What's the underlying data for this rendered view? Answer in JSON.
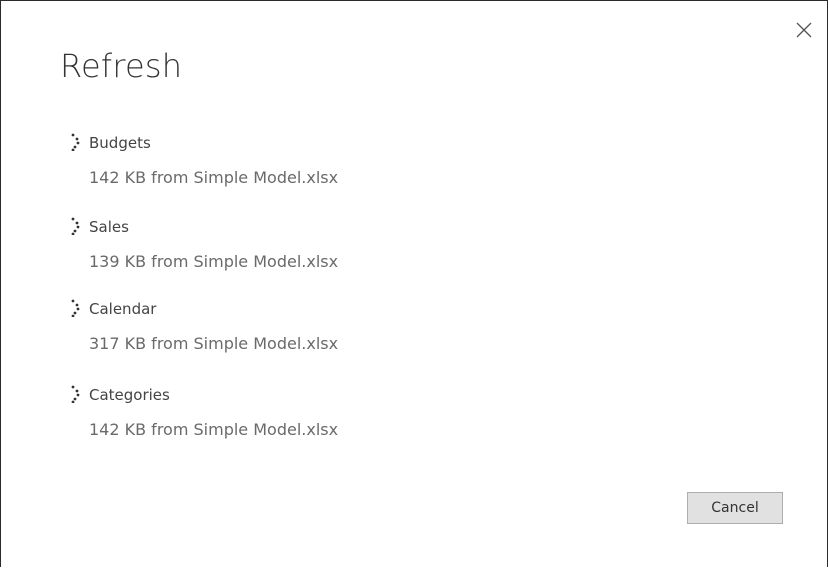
{
  "dialog": {
    "title": "Refresh",
    "close_icon": "close-icon",
    "cancel_label": "Cancel"
  },
  "queries": [
    {
      "name": "Budgets",
      "detail": "142 KB from Simple Model.xlsx",
      "icon": "loading-spinner-icon"
    },
    {
      "name": "Sales",
      "detail": "139 KB from Simple Model.xlsx",
      "icon": "loading-spinner-icon"
    },
    {
      "name": "Calendar",
      "detail": "317 KB from Simple Model.xlsx",
      "icon": "loading-spinner-icon"
    },
    {
      "name": "Categories",
      "detail": "142 KB from Simple Model.xlsx",
      "icon": "loading-spinner-icon"
    }
  ],
  "colors": {
    "title": "#333333",
    "query_name": "#444444",
    "query_detail": "#6a6a6a",
    "button_bg": "#e1e1e1",
    "button_border": "#adadad"
  }
}
